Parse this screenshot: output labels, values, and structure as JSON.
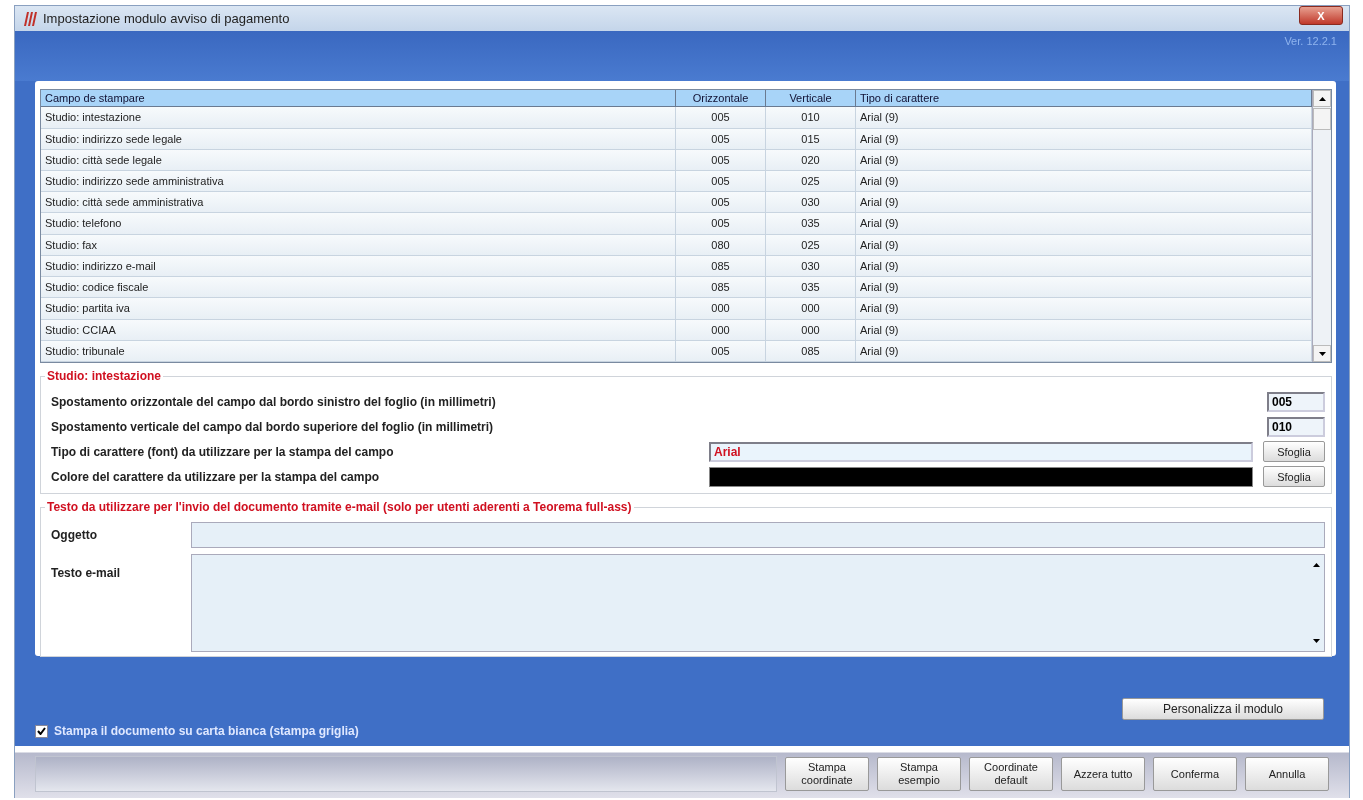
{
  "window": {
    "title": "Impostazione modulo avviso di pagamento",
    "close": "X",
    "version": "Ver. 12.2.1"
  },
  "table": {
    "columns": [
      "Campo de stampare",
      "Orizzontale",
      "Verticale",
      "Tipo di carattere"
    ],
    "rows": [
      {
        "cells": [
          "Studio: intestazione",
          "005",
          "010",
          "Arial (9)"
        ]
      },
      {
        "cells": [
          "Studio: indirizzo sede legale",
          "005",
          "015",
          "Arial (9)"
        ]
      },
      {
        "cells": [
          "Studio: città sede legale",
          "005",
          "020",
          "Arial (9)"
        ]
      },
      {
        "cells": [
          "Studio: indirizzo sede amministrativa",
          "005",
          "025",
          "Arial (9)"
        ]
      },
      {
        "cells": [
          "Studio: città sede amministrativa",
          "005",
          "030",
          "Arial (9)"
        ]
      },
      {
        "cells": [
          "Studio: telefono",
          "005",
          "035",
          "Arial (9)"
        ]
      },
      {
        "cells": [
          "Studio: fax",
          "080",
          "025",
          "Arial (9)"
        ]
      },
      {
        "cells": [
          "Studio: indirizzo e-mail",
          "085",
          "030",
          "Arial (9)"
        ]
      },
      {
        "cells": [
          "Studio: codice fiscale",
          "085",
          "035",
          "Arial (9)"
        ]
      },
      {
        "cells": [
          "Studio: partita iva",
          "000",
          "000",
          "Arial (9)"
        ]
      },
      {
        "cells": [
          "Studio: CCIAA",
          "000",
          "000",
          "Arial (9)"
        ]
      },
      {
        "cells": [
          "Studio: tribunale",
          "005",
          "085",
          "Arial (9)"
        ]
      }
    ]
  },
  "field_settings": {
    "title": "Studio: intestazione",
    "rows": [
      {
        "kind": "number",
        "label": "Spostamento orizzontale del campo dal bordo sinistro del foglio (in millimetri)",
        "value": "005"
      },
      {
        "kind": "number",
        "label": "Spostamento verticale del campo dal bordo superiore del foglio (in millimetri)",
        "value": "010"
      },
      {
        "kind": "font",
        "label": "Tipo di carattere (font) da utilizzare per la stampa del campo",
        "value": "Arial",
        "button": "Sfoglia"
      },
      {
        "kind": "color",
        "label": "Colore del carattere da utilizzare per la stampa del campo",
        "color": "#000000",
        "button": "Sfoglia"
      }
    ]
  },
  "email": {
    "title": "Testo da utilizzare per l'invio del documento tramite e-mail (solo per utenti aderenti a Teorema full-ass)",
    "subject_label": "Oggetto",
    "body_label": "Testo e-mail"
  },
  "print_on_white": {
    "label": "Stampa il documento su carta bianca (stampa griglia)",
    "checked": true
  },
  "customize_button": "Personalizza il modulo",
  "buttons": [
    "Stampa coordinate",
    "Stampa esempio",
    "Coordinate default",
    "Azzera tutto",
    "Conferma",
    "Annulla"
  ]
}
